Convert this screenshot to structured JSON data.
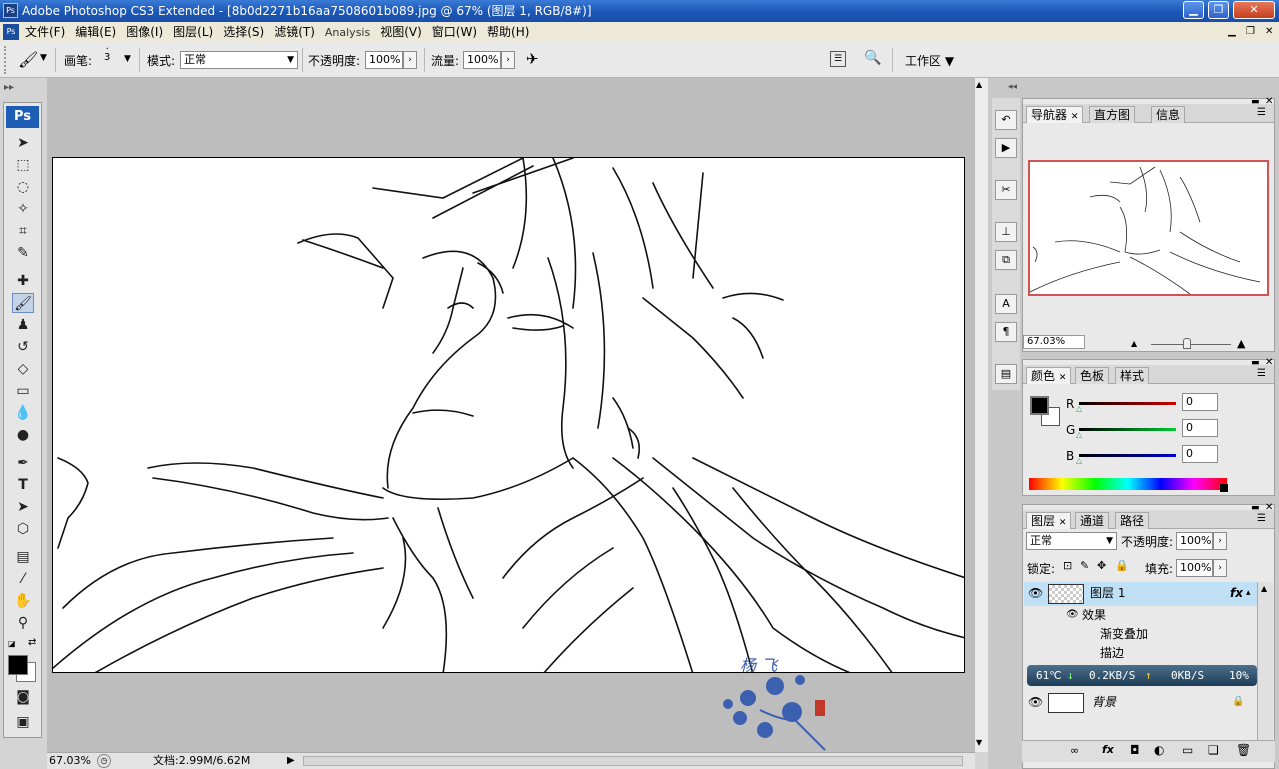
{
  "window": {
    "title": "Adobe Photoshop CS3 Extended - [8b0d2271b16aa7508601b089.jpg @ 67% (图层 1, RGB/8#)]",
    "app_icon": "Ps"
  },
  "menu": [
    "文件(F)",
    "编辑(E)",
    "图像(I)",
    "图层(L)",
    "选择(S)",
    "滤镜(T)",
    "Analysis",
    "视图(V)",
    "窗口(W)",
    "帮助(H)"
  ],
  "options": {
    "brush_label": "画笔:",
    "brush_size": "3",
    "mode_label": "模式:",
    "mode_value": "正常",
    "opacity_label": "不透明度:",
    "opacity_value": "100%",
    "flow_label": "流量:",
    "flow_value": "100%",
    "workspace_label": "工作区 ▼"
  },
  "toolbox": {
    "badge": "Ps"
  },
  "status": {
    "zoom": "67.03%",
    "doc": "文档:2.99M/6.62M"
  },
  "navigator": {
    "tabs": [
      "导航器",
      "直方图",
      "信息"
    ],
    "zoom": "67.03%"
  },
  "color": {
    "tabs": [
      "颜色",
      "色板",
      "样式"
    ],
    "channels": [
      {
        "name": "R",
        "value": "0",
        "color": "#cc0000"
      },
      {
        "name": "G",
        "value": "0",
        "color": "#00aa00"
      },
      {
        "name": "B",
        "value": "0",
        "color": "#0000cc"
      }
    ]
  },
  "layers": {
    "tabs": [
      "图层",
      "通道",
      "路径"
    ],
    "blend": "正常",
    "opacity_label": "不透明度:",
    "opacity": "100%",
    "lock_label": "锁定:",
    "fill_label": "填充:",
    "fill": "100%",
    "items": [
      {
        "name": "图层 1",
        "fx": "fx",
        "effects_label": "效果",
        "effects": [
          "渐变叠加",
          "描边"
        ]
      },
      {
        "name": "背景"
      }
    ]
  },
  "netmonitor": {
    "temp": "61℃",
    "down": "0.2KB/S",
    "up": "0KB/S",
    "pct": "10%"
  },
  "watermark_text": "杨 飞"
}
